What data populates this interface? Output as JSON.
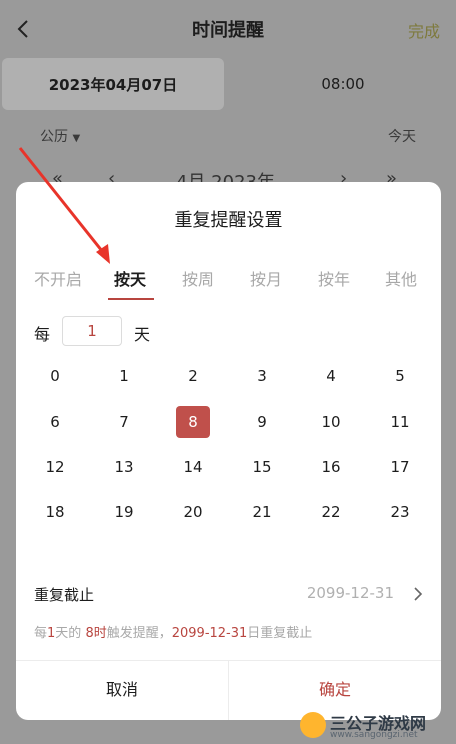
{
  "header": {
    "title": "时间提醒",
    "done_label": "完成"
  },
  "date_bar": {
    "date": "2023年04月07日",
    "time": "08:00"
  },
  "calendar": {
    "type": "公历",
    "today": "今天",
    "month_label": "4月 2023年"
  },
  "dialog": {
    "title": "重复提醒设置",
    "tabs": [
      "不开启",
      "按天",
      "按周",
      "按月",
      "按年",
      "其他"
    ],
    "active_tab": "按天",
    "every": {
      "prefix": "每",
      "value": "1",
      "unit": "天"
    },
    "hours": [
      "0",
      "1",
      "2",
      "3",
      "4",
      "5",
      "6",
      "7",
      "8",
      "9",
      "10",
      "11",
      "12",
      "13",
      "14",
      "15",
      "16",
      "17",
      "18",
      "19",
      "20",
      "21",
      "22",
      "23"
    ],
    "selected_hour": "8",
    "until": {
      "label": "重复截止",
      "value": "2099-12-31"
    },
    "summary": {
      "p1": "每",
      "n1": "1",
      "p2": "天的 ",
      "n2": "8时",
      "p3": "触发提醒，",
      "n3": "2099-12-31",
      "p4": "日重复截止"
    },
    "cancel_label": "取消",
    "confirm_label": "确定"
  },
  "watermark": {
    "text": "三公子游戏网",
    "url": "www.sangongzi.net"
  },
  "colors": {
    "accent": "#c0504b",
    "annotation_arrow": "#e8342a"
  }
}
